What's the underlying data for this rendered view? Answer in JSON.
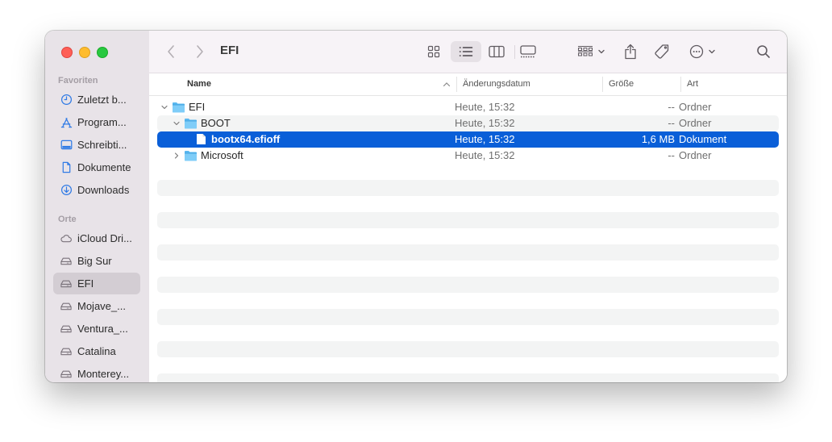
{
  "window": {
    "title": "EFI",
    "traffic_lights": [
      "close",
      "minimize",
      "zoom"
    ]
  },
  "sidebar": {
    "sections": [
      {
        "heading": "Favoriten",
        "items": [
          {
            "label": "Zuletzt b...",
            "icon": "clock-icon"
          },
          {
            "label": "Program...",
            "icon": "applications-icon"
          },
          {
            "label": "Schreibti...",
            "icon": "desktop-icon"
          },
          {
            "label": "Dokumente",
            "icon": "document-icon"
          },
          {
            "label": "Downloads",
            "icon": "download-icon"
          }
        ]
      },
      {
        "heading": "Orte",
        "items": [
          {
            "label": "iCloud Dri...",
            "icon": "cloud-icon"
          },
          {
            "label": "Big Sur",
            "icon": "drive-icon"
          },
          {
            "label": "EFI",
            "icon": "drive-icon",
            "active": true
          },
          {
            "label": "Mojave_...",
            "icon": "drive-icon"
          },
          {
            "label": "Ventura_...",
            "icon": "drive-icon"
          },
          {
            "label": "Catalina",
            "icon": "drive-icon"
          },
          {
            "label": "Monterey...",
            "icon": "drive-icon"
          }
        ]
      }
    ]
  },
  "toolbar": {
    "back": "back-icon",
    "forward": "forward-icon",
    "view_modes": [
      "icon-view",
      "list-view",
      "column-view",
      "gallery-view"
    ],
    "selected_view": "list-view",
    "group": "group-icon",
    "share": "share-icon",
    "tags": "tag-icon",
    "more": "more-icon",
    "search": "search-icon"
  },
  "columns": {
    "name": "Name",
    "date": "Änderungsdatum",
    "size": "Größe",
    "kind": "Art"
  },
  "files": [
    {
      "name": "EFI",
      "type": "folder",
      "level": 0,
      "disclosure": "expanded",
      "date": "Heute, 15:32",
      "size": "--",
      "kind": "Ordner"
    },
    {
      "name": "BOOT",
      "type": "folder",
      "level": 1,
      "disclosure": "expanded",
      "date": "Heute, 15:32",
      "size": "--",
      "kind": "Ordner"
    },
    {
      "name": "bootx64.efioff",
      "type": "file",
      "level": 2,
      "disclosure": "none",
      "date": "Heute, 15:32",
      "size": "1,6 MB",
      "kind": "Dokument",
      "selected": true
    },
    {
      "name": "Microsoft",
      "type": "folder",
      "level": 1,
      "disclosure": "collapsed",
      "date": "Heute, 15:32",
      "size": "--",
      "kind": "Ordner"
    }
  ],
  "colors": {
    "selection": "#0a5fd8",
    "folder": "#5ab8f0",
    "sidebar_accent": "#2f7ae5"
  }
}
